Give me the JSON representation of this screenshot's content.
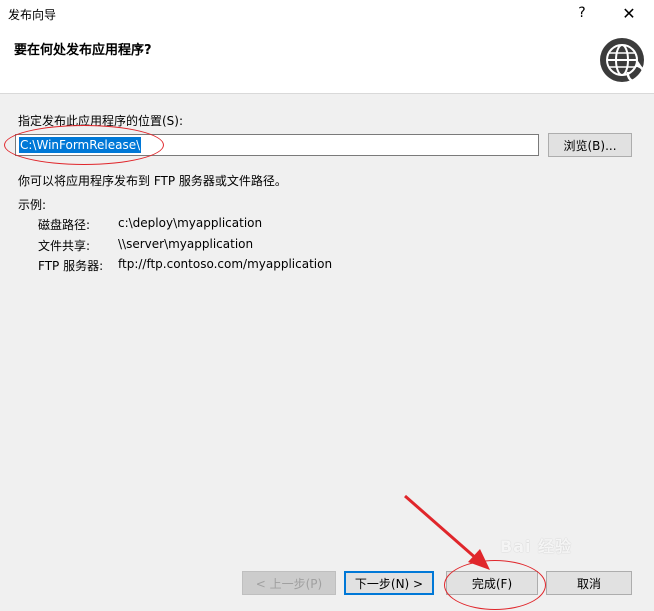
{
  "window": {
    "title": "发布向导",
    "help_label": "?",
    "close_label": "✕"
  },
  "header": {
    "title": "要在何处发布应用程序?",
    "icon": "globe-publish-icon"
  },
  "location": {
    "label": "指定发布此应用程序的位置(S):",
    "value": "C:\\WinFormRelease\\",
    "browse_label": "浏览(B)..."
  },
  "hint": "你可以将应用程序发布到 FTP 服务器或文件路径。",
  "examples": {
    "label": "示例:",
    "rows": [
      {
        "key": "磁盘路径:",
        "value": "c:\\deploy\\myapplication"
      },
      {
        "key": "文件共享:",
        "value": "\\\\server\\myapplication"
      },
      {
        "key": "FTP 服务器:",
        "value": "ftp://ftp.contoso.com/myapplication"
      }
    ]
  },
  "buttons": {
    "prev_label": "< 上一步(P)",
    "next_label": "下一步(N) >",
    "finish_label": "完成(F)",
    "cancel_label": "取消"
  },
  "watermark": "Bai 经验",
  "colors": {
    "selection": "#0078d7",
    "annotation": "#e0262b",
    "panel_bg": "#f0f0f0"
  }
}
